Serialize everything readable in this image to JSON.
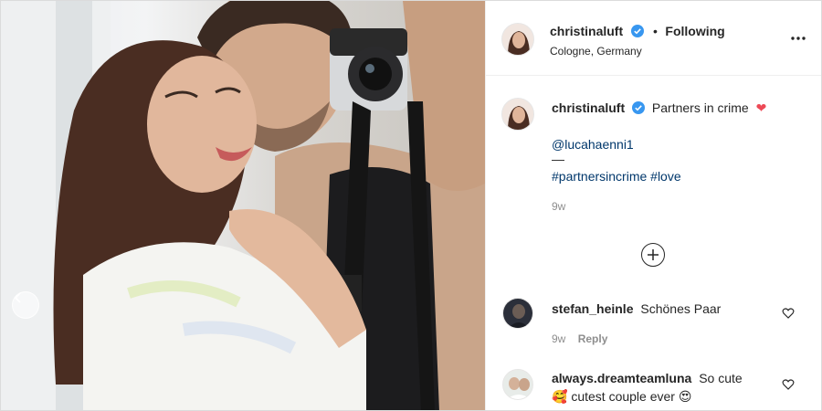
{
  "post": {
    "author": "christinaluft",
    "follow_status": "Following",
    "location": "Cologne, Germany",
    "more_icon": "more-horizontal-icon"
  },
  "caption": {
    "author": "christinaluft",
    "text": "Partners in crime",
    "emoji": "❤",
    "mention": "@lucahaenni1",
    "divider": "—",
    "hashtags": "#partnersincrime #love",
    "timestamp": "9w"
  },
  "load_more_icon": "plus-circle-icon",
  "comments": [
    {
      "author": "stefan_heinle",
      "text": "Schönes Paar",
      "timestamp": "9w",
      "reply_label": "Reply"
    },
    {
      "author": "always.dreamteamluna",
      "text_part1": "So cute",
      "emoji1": "🥰",
      "text_part2": "cutest couple ever",
      "emoji2": "😍"
    }
  ],
  "colors": {
    "verified": "#3897f0",
    "link": "#00376b",
    "heart": "#ed4956"
  }
}
